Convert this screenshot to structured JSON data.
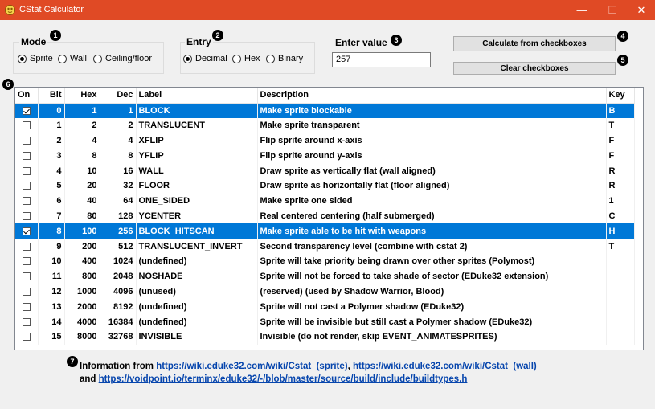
{
  "window": {
    "title": "CStat Calculator",
    "minimize": "—",
    "maximize": "☐",
    "close": "✕"
  },
  "badges": [
    "1",
    "2",
    "3",
    "4",
    "5",
    "6",
    "7"
  ],
  "mode": {
    "title": "Mode",
    "options": [
      "Sprite",
      "Wall",
      "Ceiling/floor"
    ],
    "selected": "Sprite"
  },
  "entry": {
    "title": "Entry",
    "options": [
      "Decimal",
      "Hex",
      "Binary"
    ],
    "selected": "Decimal"
  },
  "enter_value": {
    "label": "Enter value",
    "value": "257"
  },
  "buttons": {
    "calculate": "Calculate from checkboxes",
    "clear": "Clear checkboxes"
  },
  "table": {
    "columns": [
      "On",
      "Bit",
      "Hex",
      "Dec",
      "Label",
      "Description",
      "Key"
    ],
    "rows": [
      {
        "on": true,
        "bit": "0",
        "hex": "1",
        "dec": "1",
        "label": "BLOCK",
        "description": "Make sprite blockable",
        "key": "B",
        "selected": true
      },
      {
        "on": false,
        "bit": "1",
        "hex": "2",
        "dec": "2",
        "label": "TRANSLUCENT",
        "description": "Make sprite transparent",
        "key": "T"
      },
      {
        "on": false,
        "bit": "2",
        "hex": "4",
        "dec": "4",
        "label": "XFLIP",
        "description": "Flip sprite around x-axis",
        "key": "F"
      },
      {
        "on": false,
        "bit": "3",
        "hex": "8",
        "dec": "8",
        "label": "YFLIP",
        "description": "Flip sprite around y-axis",
        "key": "F"
      },
      {
        "on": false,
        "bit": "4",
        "hex": "10",
        "dec": "16",
        "label": "WALL",
        "description": "Draw sprite as vertically flat (wall aligned)",
        "key": "R"
      },
      {
        "on": false,
        "bit": "5",
        "hex": "20",
        "dec": "32",
        "label": "FLOOR",
        "description": "Draw sprite as horizontally flat (floor aligned)",
        "key": "R"
      },
      {
        "on": false,
        "bit": "6",
        "hex": "40",
        "dec": "64",
        "label": "ONE_SIDED",
        "description": "Make sprite one sided",
        "key": "1"
      },
      {
        "on": false,
        "bit": "7",
        "hex": "80",
        "dec": "128",
        "label": "YCENTER",
        "description": "Real centered centering (half submerged)",
        "key": "C"
      },
      {
        "on": true,
        "bit": "8",
        "hex": "100",
        "dec": "256",
        "label": "BLOCK_HITSCAN",
        "description": "Make sprite able to be hit with weapons",
        "key": "H",
        "selected": true
      },
      {
        "on": false,
        "bit": "9",
        "hex": "200",
        "dec": "512",
        "label": "TRANSLUCENT_INVERT",
        "description": "Second transparency level (combine with cstat 2)",
        "key": "T"
      },
      {
        "on": false,
        "bit": "10",
        "hex": "400",
        "dec": "1024",
        "label": "(undefined)",
        "description": "Sprite will take priority being drawn over other sprites (Polymost)",
        "key": ""
      },
      {
        "on": false,
        "bit": "11",
        "hex": "800",
        "dec": "2048",
        "label": "NOSHADE",
        "description": "Sprite will not be forced to take shade of sector (EDuke32 extension)",
        "key": ""
      },
      {
        "on": false,
        "bit": "12",
        "hex": "1000",
        "dec": "4096",
        "label": "(unused)",
        "description": "(reserved) (used by Shadow Warrior, Blood)",
        "key": ""
      },
      {
        "on": false,
        "bit": "13",
        "hex": "2000",
        "dec": "8192",
        "label": "(undefined)",
        "description": "Sprite will not cast a Polymer shadow (EDuke32)",
        "key": ""
      },
      {
        "on": false,
        "bit": "14",
        "hex": "4000",
        "dec": "16384",
        "label": "(undefined)",
        "description": "Sprite will be invisible but still cast a Polymer shadow (EDuke32)",
        "key": ""
      },
      {
        "on": false,
        "bit": "15",
        "hex": "8000",
        "dec": "32768",
        "label": "INVISIBLE",
        "description": "Invisible (do not render, skip EVENT_ANIMATESPRITES)",
        "key": ""
      }
    ]
  },
  "info": {
    "prefix": "Information from ",
    "link1": "https://wiki.eduke32.com/wiki/Cstat_(sprite)",
    "sep": ", ",
    "link2": "https://wiki.eduke32.com/wiki/Cstat_(wall)",
    "and": "and ",
    "link3": "https://voidpoint.io/terminx/eduke32/-/blob/master/source/build/include/buildtypes.h"
  },
  "colors": {
    "titlebar": "#e04a25",
    "selection": "#0078d7",
    "link": "#0645ad"
  }
}
